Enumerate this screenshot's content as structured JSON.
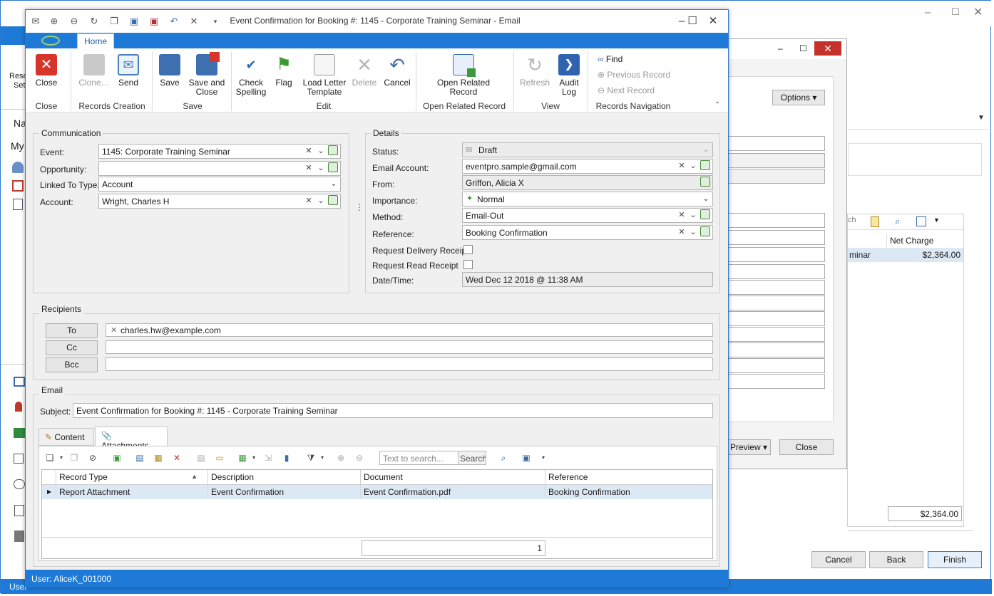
{
  "background_window": {
    "sidebar_labels": [
      "Rese",
      "Set",
      "Na",
      "My"
    ],
    "status_prefix": "User",
    "middle_dialog": {
      "options_label": "Options",
      "grid_header": "Net Charge",
      "grid_row_label": "minar",
      "grid_row_value": "$2,364.00",
      "search_fragment": "ch",
      "total_value": "$2,364.00",
      "preview_label": "Preview",
      "close_label": "Close"
    },
    "footer_buttons": {
      "cancel": "Cancel",
      "back": "Back",
      "finish": "Finish"
    }
  },
  "window": {
    "title": "Event Confirmation for Booking #: 1145 - Corporate Training Seminar - Email",
    "tab_home": "Home"
  },
  "ribbon": {
    "close": "Close",
    "clone": "Clone…",
    "send": "Send",
    "save": "Save",
    "save_and_close_1": "Save and",
    "save_and_close_2": "Close",
    "check_spelling_1": "Check",
    "check_spelling_2": "Spelling",
    "flag": "Flag",
    "load_letter_1": "Load Letter",
    "load_letter_2": "Template",
    "delete": "Delete",
    "cancel": "Cancel",
    "open_related_1": "Open Related",
    "open_related_2": "Record",
    "refresh": "Refresh",
    "audit_log_1": "Audit",
    "audit_log_2": "Log",
    "find": "Find",
    "previous_record": "Previous Record",
    "next_record": "Next Record",
    "groups": {
      "close": "Close",
      "records_creation": "Records Creation",
      "save": "Save",
      "edit": "Edit",
      "open_related_record": "Open Related Record",
      "view": "View",
      "records_navigation": "Records Navigation"
    }
  },
  "communication": {
    "title": "Communication",
    "event_label": "Event:",
    "event_value": "1145: Corporate Training Seminar",
    "opportunity_label": "Opportunity:",
    "opportunity_value": "",
    "linked_label": "Linked To Type:",
    "linked_value": "Account",
    "account_label": "Account:",
    "account_value": "Wright, Charles H"
  },
  "details": {
    "title": "Details",
    "status_label": "Status:",
    "status_value": "Draft",
    "email_account_label": "Email Account:",
    "email_account_value": "eventpro.sample@gmail.com",
    "from_label": "From:",
    "from_value": "Griffon, Alicia X",
    "importance_label": "Importance:",
    "importance_value": "Normal",
    "method_label": "Method:",
    "method_value": "Email-Out",
    "reference_label": "Reference:",
    "reference_value": "Booking Confirmation",
    "delivery_receipt_label": "Request Delivery Receipt",
    "read_receipt_label": "Request Read Receipt",
    "datetime_label": "Date/Time:",
    "datetime_value": "Wed Dec 12 2018 @ 11:38 AM"
  },
  "recipients": {
    "title": "Recipients",
    "to_label": "To",
    "cc_label": "Cc",
    "bcc_label": "Bcc",
    "to_value": "charles.hw@example.com",
    "cc_value": "",
    "bcc_value": ""
  },
  "email": {
    "title": "Email",
    "subject_label": "Subject:",
    "subject_value": "Event Confirmation for Booking #: 1145 - Corporate Training Seminar",
    "tab_content": "Content",
    "tab_attachments": "Attachments",
    "search_placeholder": "Text to search...",
    "search_button": "Search",
    "columns": [
      "Record Type",
      "Description",
      "Document",
      "Reference"
    ],
    "rows": [
      {
        "record_type": "Report Attachment",
        "description": "Event Confirmation",
        "document": "Event Confirmation.pdf",
        "reference": "Booking Confirmation"
      }
    ],
    "footer_count": "1"
  },
  "status_bar": {
    "user": "User: AliceK_001000"
  },
  "colors": {
    "accent": "#1e7ad6",
    "close_red": "#c4312b",
    "selected_row": "#dde8f5"
  }
}
